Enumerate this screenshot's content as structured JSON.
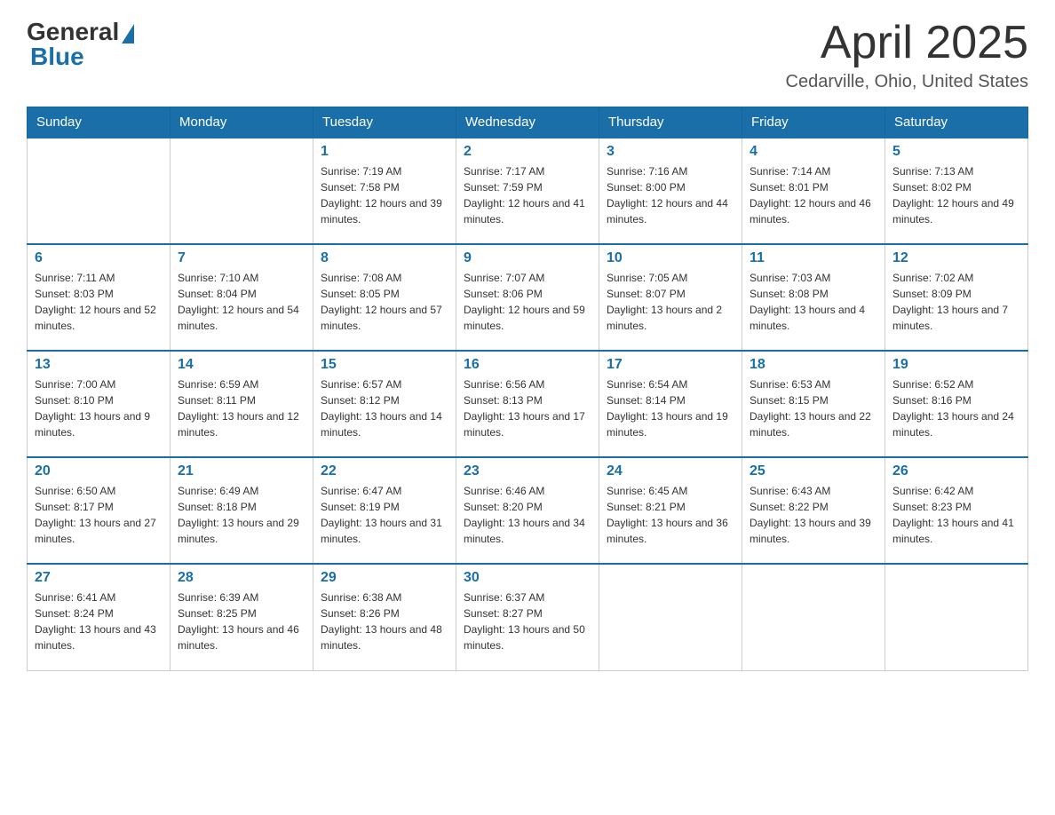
{
  "logo": {
    "general": "General",
    "blue": "Blue"
  },
  "title": {
    "month_year": "April 2025",
    "location": "Cedarville, Ohio, United States"
  },
  "days_of_week": [
    "Sunday",
    "Monday",
    "Tuesday",
    "Wednesday",
    "Thursday",
    "Friday",
    "Saturday"
  ],
  "weeks": [
    [
      {
        "day": "",
        "info": ""
      },
      {
        "day": "",
        "info": ""
      },
      {
        "day": "1",
        "info": "Sunrise: 7:19 AM\nSunset: 7:58 PM\nDaylight: 12 hours and 39 minutes."
      },
      {
        "day": "2",
        "info": "Sunrise: 7:17 AM\nSunset: 7:59 PM\nDaylight: 12 hours and 41 minutes."
      },
      {
        "day": "3",
        "info": "Sunrise: 7:16 AM\nSunset: 8:00 PM\nDaylight: 12 hours and 44 minutes."
      },
      {
        "day": "4",
        "info": "Sunrise: 7:14 AM\nSunset: 8:01 PM\nDaylight: 12 hours and 46 minutes."
      },
      {
        "day": "5",
        "info": "Sunrise: 7:13 AM\nSunset: 8:02 PM\nDaylight: 12 hours and 49 minutes."
      }
    ],
    [
      {
        "day": "6",
        "info": "Sunrise: 7:11 AM\nSunset: 8:03 PM\nDaylight: 12 hours and 52 minutes."
      },
      {
        "day": "7",
        "info": "Sunrise: 7:10 AM\nSunset: 8:04 PM\nDaylight: 12 hours and 54 minutes."
      },
      {
        "day": "8",
        "info": "Sunrise: 7:08 AM\nSunset: 8:05 PM\nDaylight: 12 hours and 57 minutes."
      },
      {
        "day": "9",
        "info": "Sunrise: 7:07 AM\nSunset: 8:06 PM\nDaylight: 12 hours and 59 minutes."
      },
      {
        "day": "10",
        "info": "Sunrise: 7:05 AM\nSunset: 8:07 PM\nDaylight: 13 hours and 2 minutes."
      },
      {
        "day": "11",
        "info": "Sunrise: 7:03 AM\nSunset: 8:08 PM\nDaylight: 13 hours and 4 minutes."
      },
      {
        "day": "12",
        "info": "Sunrise: 7:02 AM\nSunset: 8:09 PM\nDaylight: 13 hours and 7 minutes."
      }
    ],
    [
      {
        "day": "13",
        "info": "Sunrise: 7:00 AM\nSunset: 8:10 PM\nDaylight: 13 hours and 9 minutes."
      },
      {
        "day": "14",
        "info": "Sunrise: 6:59 AM\nSunset: 8:11 PM\nDaylight: 13 hours and 12 minutes."
      },
      {
        "day": "15",
        "info": "Sunrise: 6:57 AM\nSunset: 8:12 PM\nDaylight: 13 hours and 14 minutes."
      },
      {
        "day": "16",
        "info": "Sunrise: 6:56 AM\nSunset: 8:13 PM\nDaylight: 13 hours and 17 minutes."
      },
      {
        "day": "17",
        "info": "Sunrise: 6:54 AM\nSunset: 8:14 PM\nDaylight: 13 hours and 19 minutes."
      },
      {
        "day": "18",
        "info": "Sunrise: 6:53 AM\nSunset: 8:15 PM\nDaylight: 13 hours and 22 minutes."
      },
      {
        "day": "19",
        "info": "Sunrise: 6:52 AM\nSunset: 8:16 PM\nDaylight: 13 hours and 24 minutes."
      }
    ],
    [
      {
        "day": "20",
        "info": "Sunrise: 6:50 AM\nSunset: 8:17 PM\nDaylight: 13 hours and 27 minutes."
      },
      {
        "day": "21",
        "info": "Sunrise: 6:49 AM\nSunset: 8:18 PM\nDaylight: 13 hours and 29 minutes."
      },
      {
        "day": "22",
        "info": "Sunrise: 6:47 AM\nSunset: 8:19 PM\nDaylight: 13 hours and 31 minutes."
      },
      {
        "day": "23",
        "info": "Sunrise: 6:46 AM\nSunset: 8:20 PM\nDaylight: 13 hours and 34 minutes."
      },
      {
        "day": "24",
        "info": "Sunrise: 6:45 AM\nSunset: 8:21 PM\nDaylight: 13 hours and 36 minutes."
      },
      {
        "day": "25",
        "info": "Sunrise: 6:43 AM\nSunset: 8:22 PM\nDaylight: 13 hours and 39 minutes."
      },
      {
        "day": "26",
        "info": "Sunrise: 6:42 AM\nSunset: 8:23 PM\nDaylight: 13 hours and 41 minutes."
      }
    ],
    [
      {
        "day": "27",
        "info": "Sunrise: 6:41 AM\nSunset: 8:24 PM\nDaylight: 13 hours and 43 minutes."
      },
      {
        "day": "28",
        "info": "Sunrise: 6:39 AM\nSunset: 8:25 PM\nDaylight: 13 hours and 46 minutes."
      },
      {
        "day": "29",
        "info": "Sunrise: 6:38 AM\nSunset: 8:26 PM\nDaylight: 13 hours and 48 minutes."
      },
      {
        "day": "30",
        "info": "Sunrise: 6:37 AM\nSunset: 8:27 PM\nDaylight: 13 hours and 50 minutes."
      },
      {
        "day": "",
        "info": ""
      },
      {
        "day": "",
        "info": ""
      },
      {
        "day": "",
        "info": ""
      }
    ]
  ]
}
